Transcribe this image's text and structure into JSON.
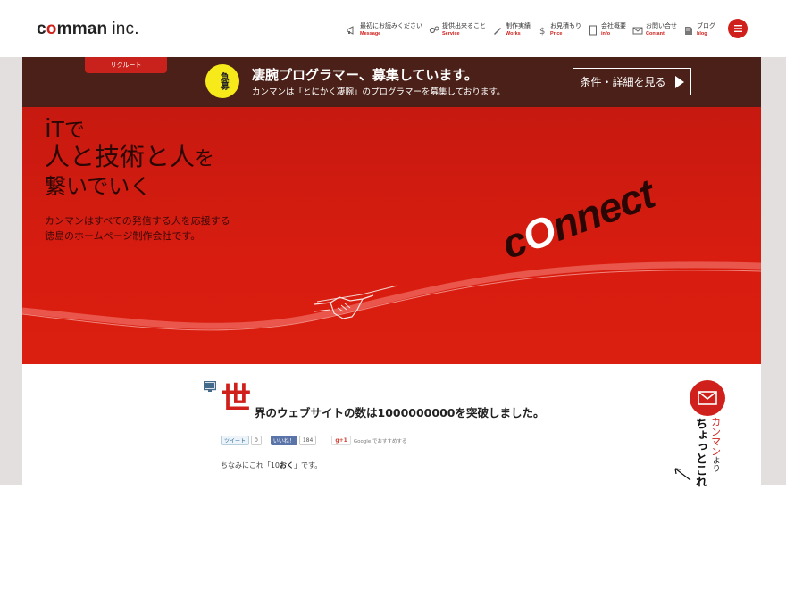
{
  "header": {
    "logo": {
      "part1": "c",
      "o": "o",
      "part2": "mman",
      "inc": "inc."
    },
    "nav": [
      {
        "jp": "最初にお読みください",
        "en": "Message",
        "icon": "megaphone-icon"
      },
      {
        "jp": "提供出来ること",
        "en": "Service",
        "icon": "gears-icon"
      },
      {
        "jp": "制作実績",
        "en": "Works",
        "icon": "pen-icon"
      },
      {
        "jp": "お見積もり",
        "en": "Price",
        "icon": "dollar-icon"
      },
      {
        "jp": "会社概要",
        "en": "info",
        "icon": "document-icon"
      },
      {
        "jp": "お問い合せ",
        "en": "Contant",
        "icon": "envelope-icon"
      },
      {
        "jp": "ブログ",
        "en": "blog",
        "icon": "book-icon"
      }
    ],
    "menu_icon": "hamburger-icon"
  },
  "recruit": {
    "tab": "リクルート",
    "badge": "急募",
    "title": "凄腕プログラマー、募集しています。",
    "subtitle": "カンマンは「とにかく凄腕」のプログラマーを募集しております。",
    "button": "条件・詳細を見る"
  },
  "hero": {
    "line1_a": "i",
    "line1_b": "Tで",
    "line2_a": "人と技術と人",
    "line2_b": "を",
    "line3": "繋いでいく",
    "desc1": "カンマンはすべての発信する人を応援する",
    "desc2": "徳島のホームページ制作会社です。",
    "connect_a": "c",
    "connect_o": "O",
    "connect_b": "nnect"
  },
  "post": {
    "big_char": "世",
    "title": "界のウェブサイトの数は1000000000を突破しました。",
    "tweet": "ツイート",
    "tweet_count": "0",
    "like": "いいね！",
    "like_count": "184",
    "gplus": "g+1",
    "gplus_label": "Google でおすすめする",
    "body_a": "ちなみにこれ「10",
    "body_b": "おく",
    "body_c": "」です。"
  },
  "side": {
    "line1": "カンマン",
    "line1_suffix": "より",
    "line2": "ちょっとこれ"
  },
  "colors": {
    "brand_red": "#d0201b",
    "recruit_bar": "#4b2018",
    "badge_yellow": "#f7ea1a"
  }
}
